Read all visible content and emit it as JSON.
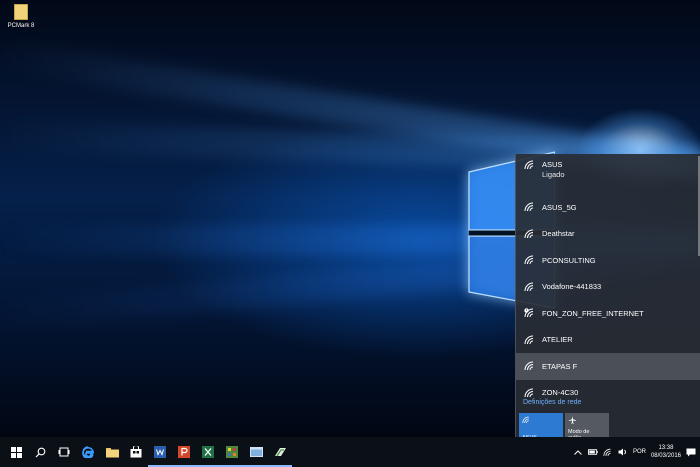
{
  "desktop": {
    "icons": [
      {
        "label": "PCMark 8",
        "icon": "folder-icon"
      }
    ]
  },
  "network_flyout": {
    "networks": [
      {
        "name": "ASUS",
        "status": "Ligado",
        "icon": "wifi-icon"
      },
      {
        "name": "ASUS_5G",
        "status": "",
        "icon": "wifi-icon"
      },
      {
        "name": "Deathstar",
        "status": "",
        "icon": "wifi-icon"
      },
      {
        "name": "PCONSULTING",
        "status": "",
        "icon": "wifi-icon"
      },
      {
        "name": "Vodafone-441833",
        "status": "",
        "icon": "wifi-icon"
      },
      {
        "name": "FON_ZON_FREE_INTERNET",
        "status": "",
        "icon": "wifi-open-icon"
      },
      {
        "name": "ATELIER",
        "status": "",
        "icon": "wifi-icon"
      },
      {
        "name": "ETAPAS F",
        "status": "",
        "icon": "wifi-icon"
      },
      {
        "name": "ZON-4C30",
        "status": "",
        "icon": "wifi-icon"
      }
    ],
    "settings_link": "Definições de rede",
    "quick_actions": [
      {
        "label": "ASUS",
        "icon": "wifi-icon",
        "active": true
      },
      {
        "label_lines": [
          "Modo de",
          "avião"
        ],
        "icon": "airplane-icon",
        "active": false
      }
    ]
  },
  "taskbar": {
    "apps": [
      {
        "name": "start",
        "icon": "windows-icon"
      },
      {
        "name": "search",
        "icon": "search-icon"
      },
      {
        "name": "task-view",
        "icon": "task-view-icon"
      },
      {
        "name": "edge",
        "icon": "edge-icon"
      },
      {
        "name": "file-explorer",
        "icon": "folder-icon"
      },
      {
        "name": "store",
        "icon": "store-icon"
      },
      {
        "name": "word",
        "icon": "word-icon"
      },
      {
        "name": "powerpoint",
        "icon": "powerpoint-icon"
      },
      {
        "name": "excel",
        "icon": "excel-icon"
      },
      {
        "name": "game",
        "icon": "game-icon"
      },
      {
        "name": "app-window",
        "icon": "window-icon"
      },
      {
        "name": "pcmark",
        "icon": "pcmark-icon"
      }
    ],
    "tray": {
      "language": "POR",
      "time": "13:38",
      "date": "08/03/2016"
    }
  },
  "colors": {
    "accent": "#2d7ad2",
    "link": "#6fb1ff",
    "flyout_bg": "#282c34"
  }
}
